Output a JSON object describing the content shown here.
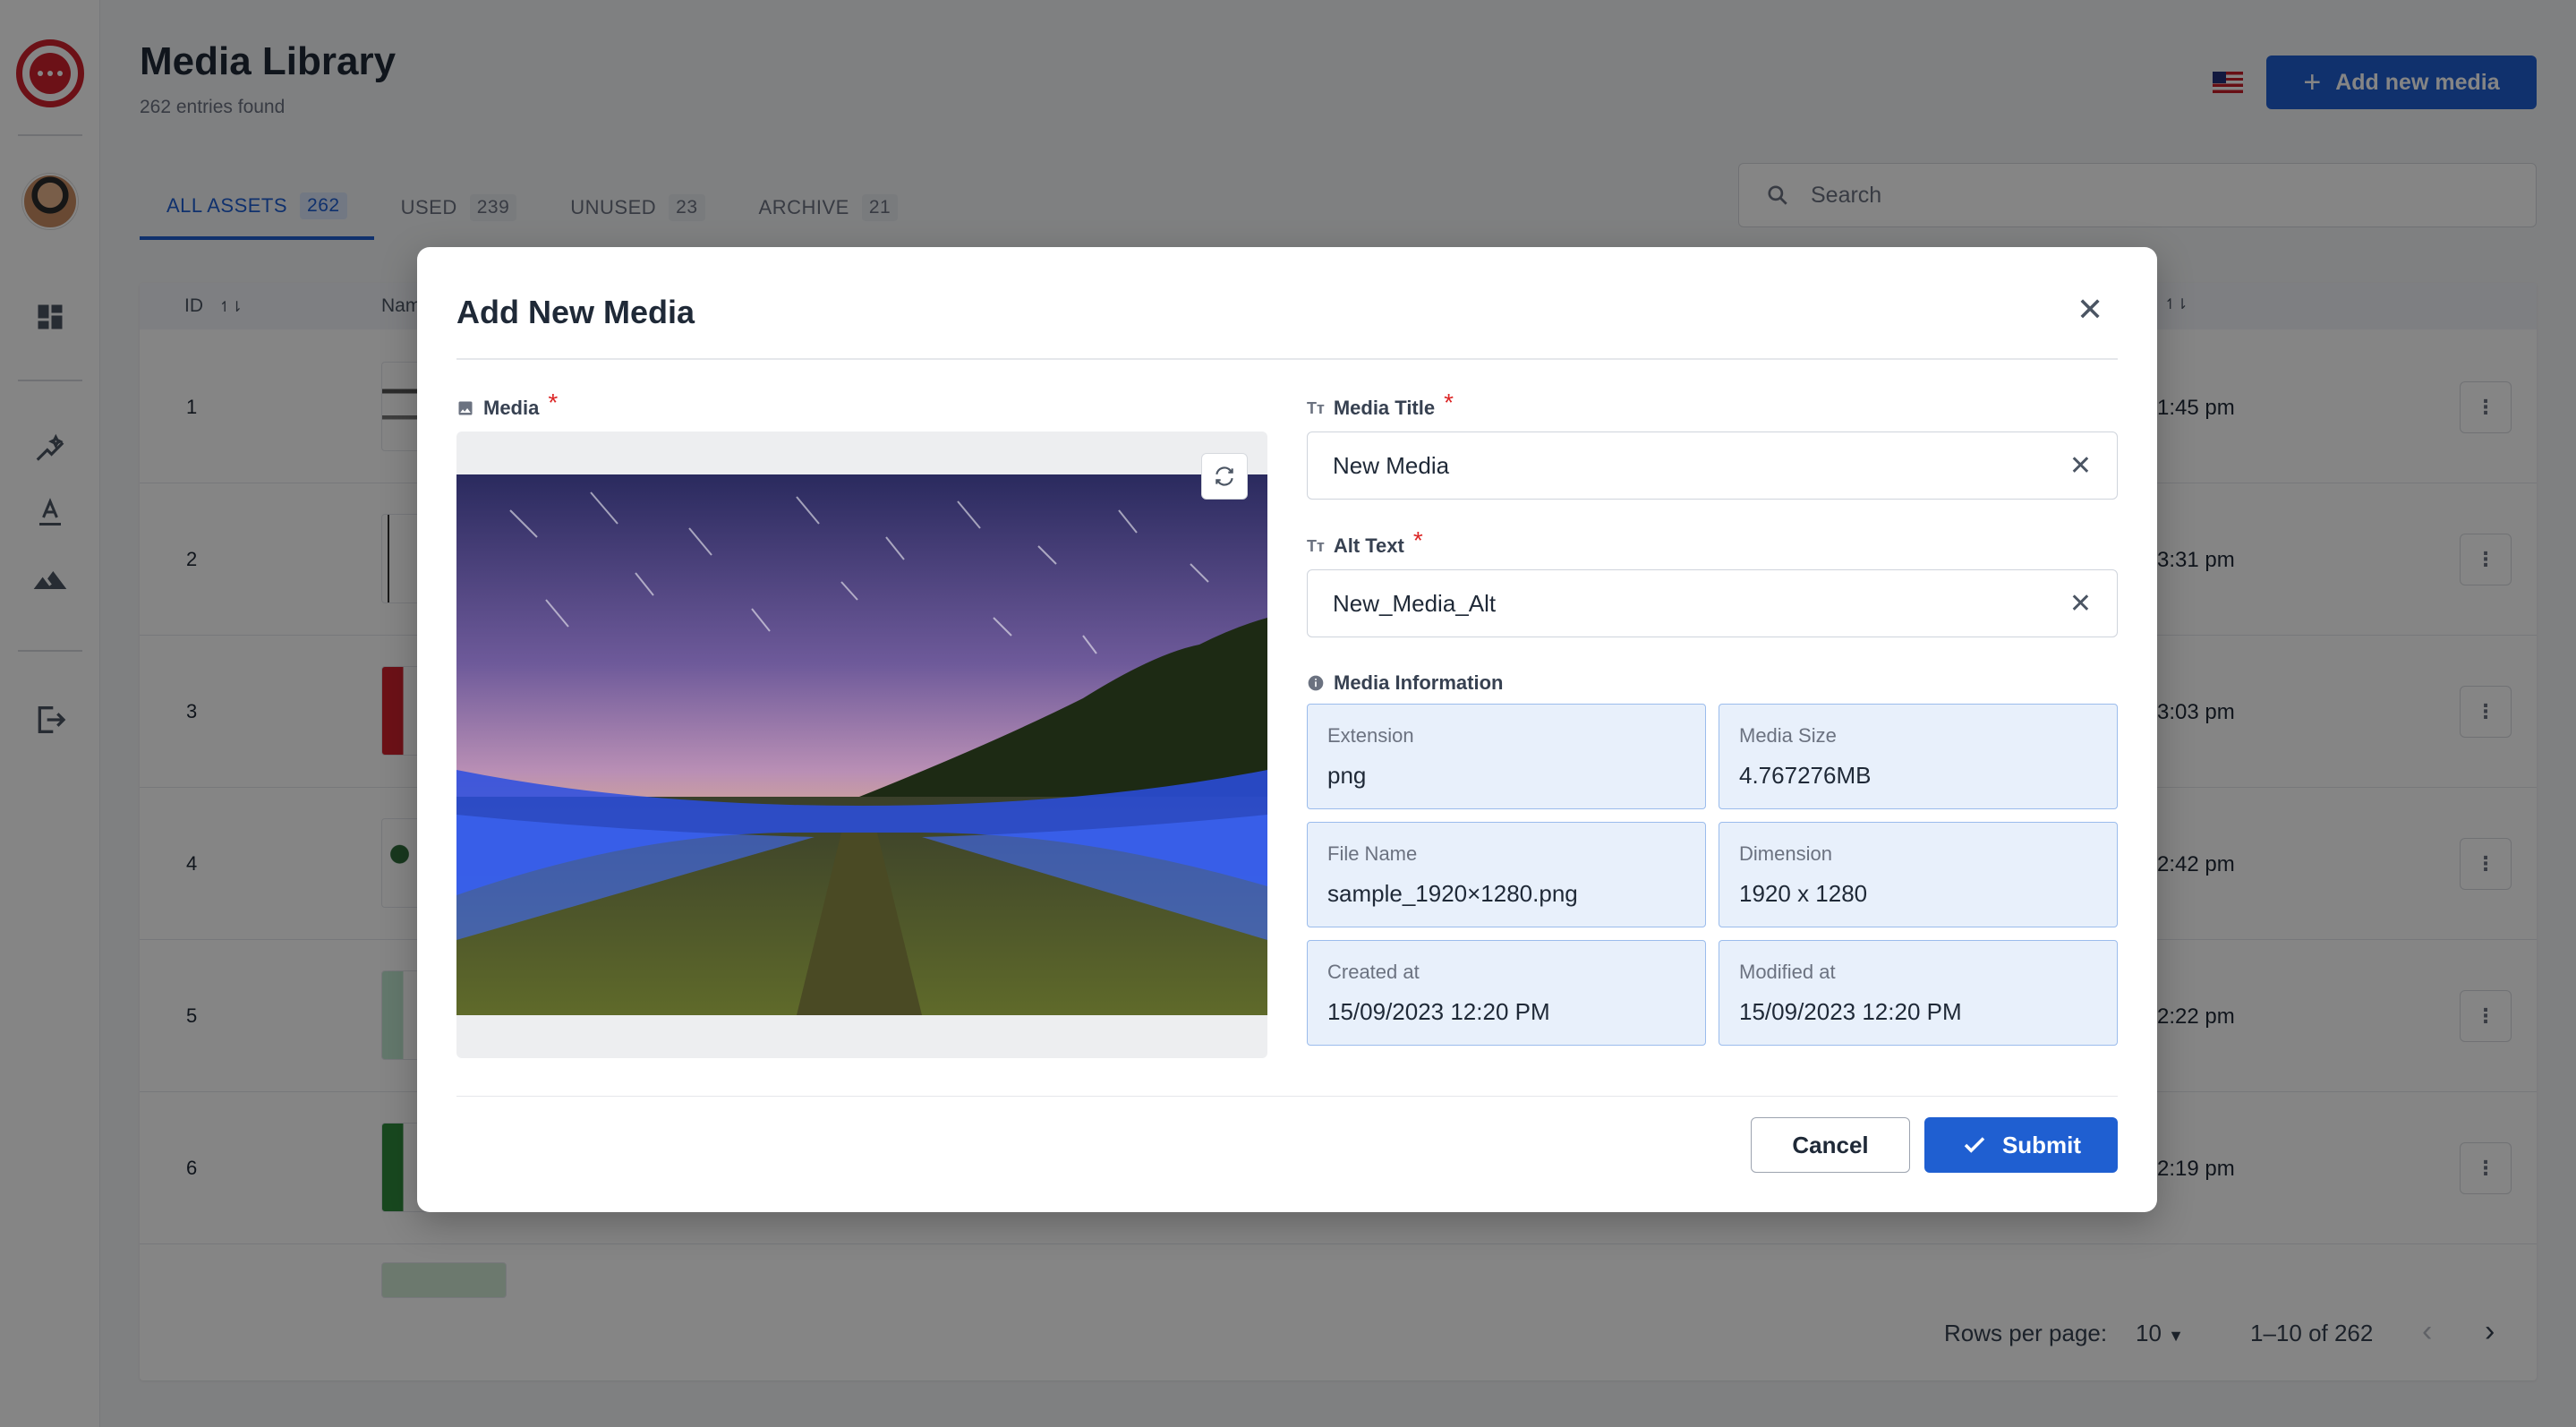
{
  "page": {
    "title": "Media Library",
    "subtitle": "262 entries found",
    "add_button_label": "Add new media"
  },
  "sidebar": {
    "items": [
      {
        "icon": "chat-logo-icon"
      },
      {
        "icon": "user-avatar"
      },
      {
        "icon": "dashboard-icon"
      },
      {
        "icon": "magic-wand-icon"
      },
      {
        "icon": "text-format-icon"
      },
      {
        "icon": "image-landscape-icon"
      },
      {
        "icon": "logout-icon"
      }
    ]
  },
  "tabs": [
    {
      "label": "ALL ASSETS",
      "count": "262"
    },
    {
      "label": "USED",
      "count": "239"
    },
    {
      "label": "UNUSED",
      "count": "23"
    },
    {
      "label": "ARCHIVE",
      "count": "21"
    }
  ],
  "search": {
    "placeholder": "Search"
  },
  "table": {
    "columns": {
      "id": "ID",
      "name": "Nam",
      "sort_icon": "↿⇂"
    },
    "rows": [
      {
        "id": "1",
        "time": "1:45 pm"
      },
      {
        "id": "2",
        "time": "3:31 pm"
      },
      {
        "id": "3",
        "time": "3:03 pm"
      },
      {
        "id": "4",
        "time": "2:42 pm"
      },
      {
        "id": "5",
        "time": "2:22 pm"
      },
      {
        "id": "6",
        "time": "2:19 pm"
      }
    ],
    "menu_glyph": "⋮"
  },
  "pagination": {
    "rows_per_page_label": "Rows per page:",
    "rows_per_page_value": "10",
    "range": "1–10 of 262"
  },
  "modal": {
    "title": "Add New Media",
    "media_label": "Media",
    "required_mark": "*",
    "title_field": {
      "label": "Media Title",
      "value": "New Media"
    },
    "alt_field": {
      "label": "Alt Text",
      "value": "New_Media_Alt"
    },
    "info_heading": "Media Information",
    "info": [
      {
        "key": "Extension",
        "value": "png"
      },
      {
        "key": "Media Size",
        "value": "4.767276MB"
      },
      {
        "key": "File Name",
        "value": "sample_1920×1280.png"
      },
      {
        "key": "Dimension",
        "value": "1920 x 1280"
      },
      {
        "key": "Created at",
        "value": "15/09/2023 12:20 PM"
      },
      {
        "key": "Modified at",
        "value": "15/09/2023 12:20 PM"
      }
    ],
    "cancel_label": "Cancel",
    "submit_label": "Submit"
  },
  "colors": {
    "primary": "#1f5fd1",
    "required": "#dc2626",
    "info_bg": "#e8f0fb",
    "info_border": "#9bbcec"
  }
}
